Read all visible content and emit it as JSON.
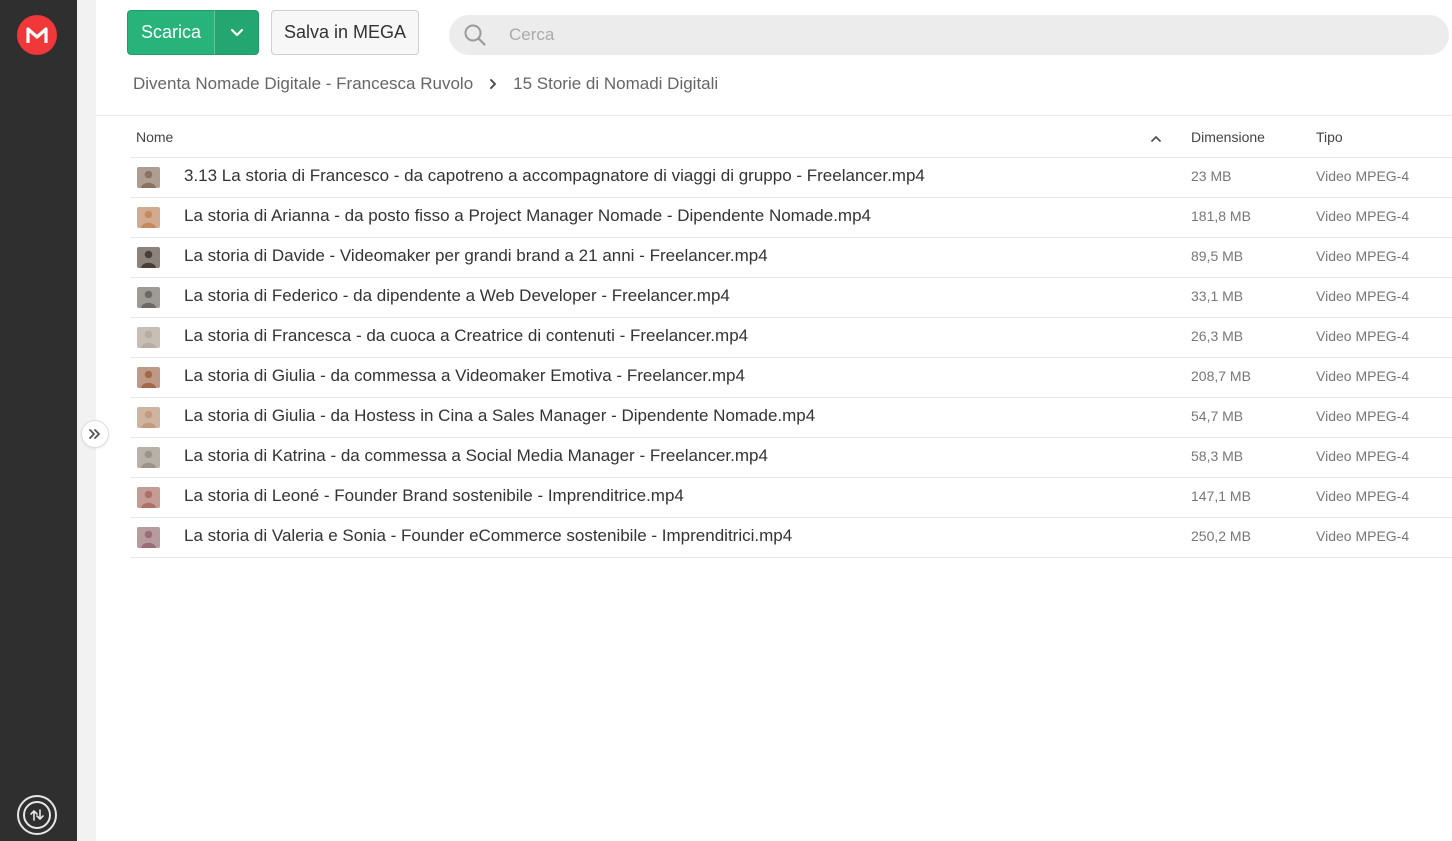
{
  "app": {
    "logo_icon": "mega-logo",
    "brand_color": "#f0373a",
    "accent_color": "#27b37a"
  },
  "toolbar": {
    "download_label": "Scarica",
    "save_label": "Salva in MEGA",
    "search_placeholder": "Cerca"
  },
  "breadcrumb": {
    "parent": "Diventa Nomade Digitale - Francesca Ruvolo",
    "current": "15 Storie di Nomadi Digitali"
  },
  "table": {
    "columns": {
      "name": "Nome",
      "size": "Dimensione",
      "type": "Tipo"
    },
    "sort": "ascending",
    "rows": [
      {
        "name": "3.13 La storia di Francesco - da capotreno a accompagnatore di viaggi di gruppo - Freelancer.mp4",
        "size": "23 MB",
        "type": "Video MPEG-4",
        "thumb_color": "#8a7160"
      },
      {
        "name": "La storia di Arianna - da posto fisso a Project Manager Nomade - Dipendente Nomade.mp4",
        "size": "181,8 MB",
        "type": "Video MPEG-4",
        "thumb_color": "#c9885e"
      },
      {
        "name": "La storia di Davide - Videomaker per grandi brand a 21 anni - Freelancer.mp4",
        "size": "89,5 MB",
        "type": "Video MPEG-4",
        "thumb_color": "#4a3e37"
      },
      {
        "name": "La storia di Federico - da dipendente a Web Developer - Freelancer.mp4",
        "size": "33,1 MB",
        "type": "Video MPEG-4",
        "thumb_color": "#6d6a66"
      },
      {
        "name": "La storia di Francesca - da cuoca a Creatrice di contenuti - Freelancer.mp4",
        "size": "26,3 MB",
        "type": "Video MPEG-4",
        "thumb_color": "#b8aca0"
      },
      {
        "name": "La storia di Giulia - da commessa a Videomaker Emotiva - Freelancer.mp4",
        "size": "208,7 MB",
        "type": "Video MPEG-4",
        "thumb_color": "#a5694a"
      },
      {
        "name": "La storia di Giulia - da Hostess in Cina a Sales Manager - Dipendente Nomade.mp4",
        "size": "54,7 MB",
        "type": "Video MPEG-4",
        "thumb_color": "#c59a7c"
      },
      {
        "name": "La storia di Katrina - da commessa a Social Media Manager - Freelancer.mp4",
        "size": "58,3 MB",
        "type": "Video MPEG-4",
        "thumb_color": "#9d9388"
      },
      {
        "name": "La storia di Leoné - Founder Brand sostenibile - Imprenditrice.mp4",
        "size": "147,1 MB",
        "type": "Video MPEG-4",
        "thumb_color": "#b06f66"
      },
      {
        "name": "La storia di Valeria e Sonia - Founder eCommerce sostenibile - Imprenditrici.mp4",
        "size": "250,2 MB",
        "type": "Video MPEG-4",
        "thumb_color": "#9a6d78"
      }
    ]
  }
}
